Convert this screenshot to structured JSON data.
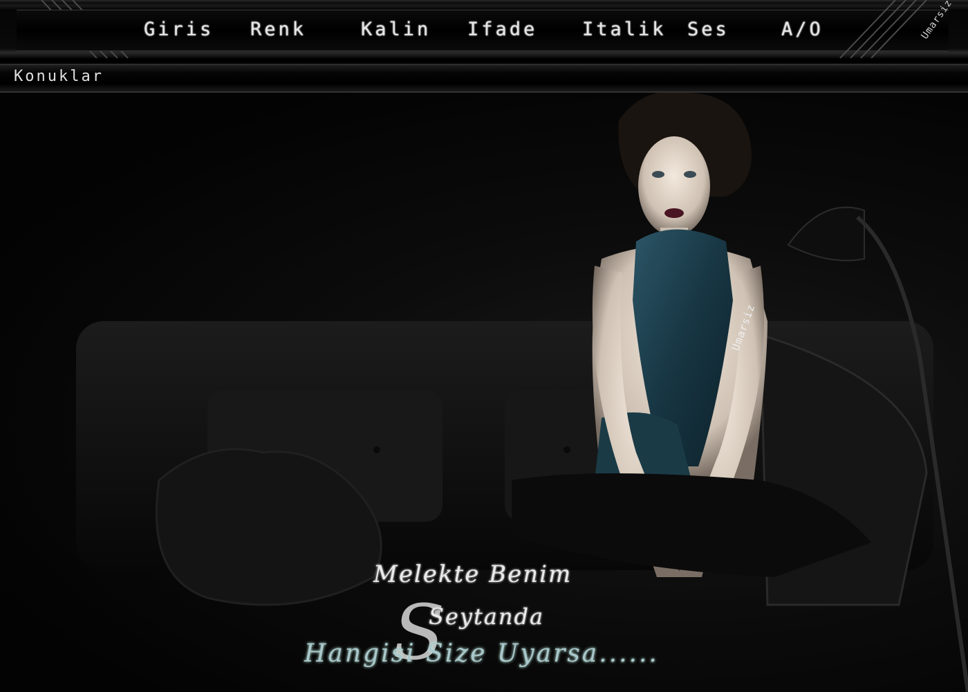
{
  "menu": {
    "items": [
      {
        "label": "Giris"
      },
      {
        "label": "Renk"
      },
      {
        "label": "Kalin"
      },
      {
        "label": "Ifade"
      },
      {
        "label": "Italik"
      },
      {
        "label": "Ses"
      },
      {
        "label": "A/O"
      }
    ],
    "corner_signature": "Umarsiz"
  },
  "subbar": {
    "guests_label": "Konuklar"
  },
  "scene": {
    "caption_line1": "Melekte Benim",
    "caption_line2": "Seytanda",
    "caption_line3": "Hangisi Size Uyarsa......",
    "big_letter": "S",
    "arm_signature": "Umarsiz"
  },
  "colors": {
    "background": "#000000",
    "text": "#e6e6e6",
    "scarf": "#1d3f4c",
    "caption_accent": "#aac8cc"
  }
}
